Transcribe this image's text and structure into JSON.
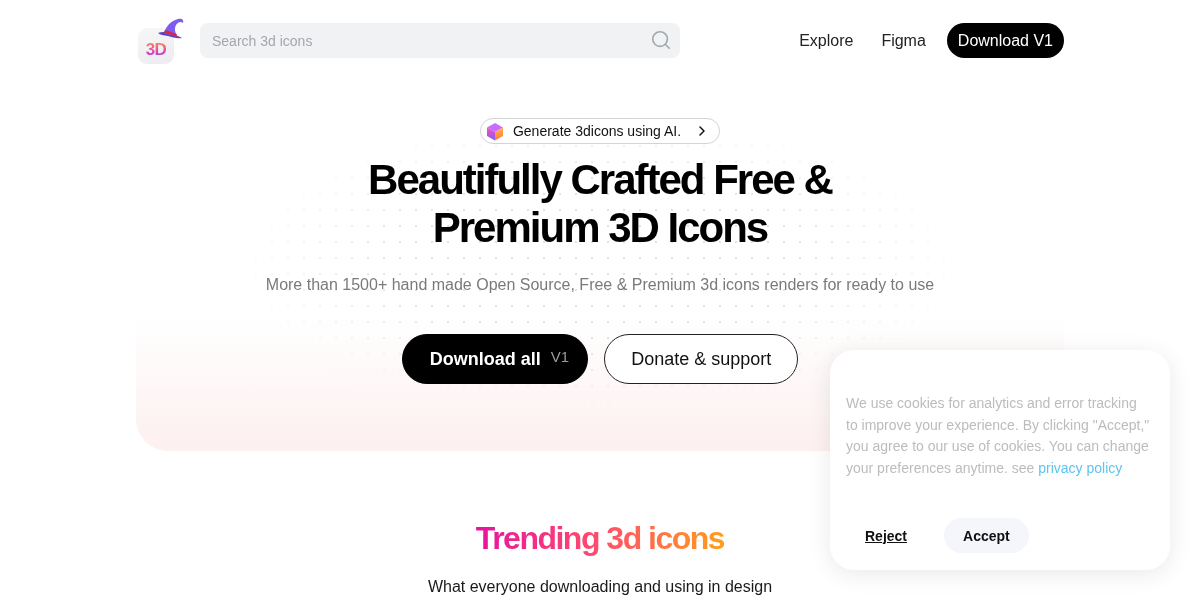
{
  "header": {
    "logo": {
      "text": "3D"
    },
    "search": {
      "placeholder": "Search 3d icons"
    },
    "nav": [
      {
        "label": "Explore",
        "kind": "link"
      },
      {
        "label": "Figma",
        "kind": "link"
      },
      {
        "label": "Download V1",
        "kind": "button"
      }
    ]
  },
  "hero": {
    "badge": {
      "label": "Generate 3dicons using AI."
    },
    "title_lines": [
      "Beautifully Crafted Free &",
      "Premium 3D Icons"
    ],
    "subtitle": "More than 1500+ hand made Open Source, Free & Premium 3d icons renders for ready to use",
    "buttons": [
      {
        "label": "Download all",
        "tag": "V1",
        "kind": "primary"
      },
      {
        "label": "Donate & support",
        "kind": "outline"
      }
    ]
  },
  "trending": {
    "title": "Trending 3d icons",
    "subtitle": "What everyone downloading and using in design"
  },
  "cookie_banner": {
    "text": "We use cookies for analytics and error tracking to improve your experience. By clicking \"Accept,\" you agree to our use of cookies. You can change your preferences anytime. see",
    "link": "privacy policy",
    "buttons": [
      {
        "label": "Reject",
        "kind": "link"
      },
      {
        "label": "Accept",
        "kind": "filled"
      }
    ]
  }
}
